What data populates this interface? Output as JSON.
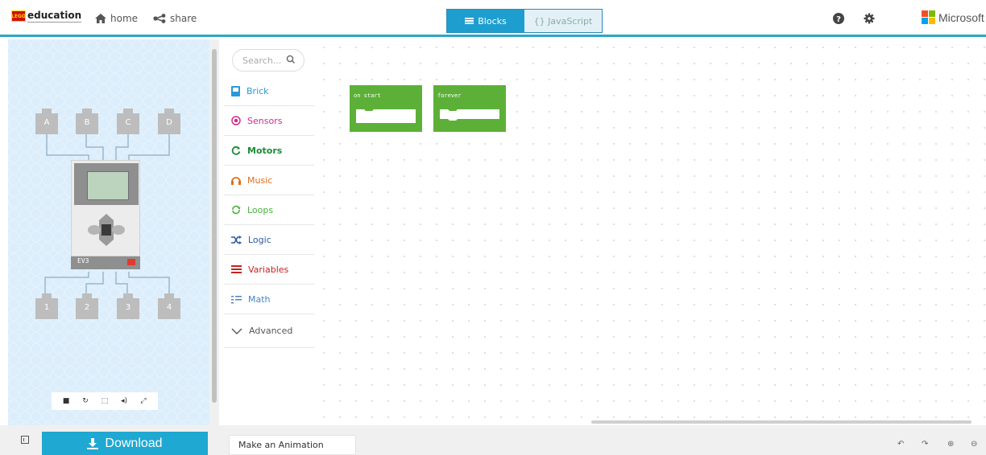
{
  "header": {
    "logo_brand": "LEGO",
    "logo_text": "education",
    "nav": {
      "home": "home",
      "share": "share"
    },
    "editor_toggle": {
      "blocks": "Blocks",
      "javascript": "{} JavaScript",
      "active": "Blocks"
    },
    "microsoft": "Microsoft",
    "icons": [
      "help-icon",
      "settings-icon"
    ]
  },
  "simulator": {
    "input_ports_top": [
      "A",
      "B",
      "C",
      "D"
    ],
    "ports_bottom": [
      "1",
      "2",
      "3",
      "4"
    ],
    "brick_label": "EV3",
    "controls": [
      "stop-icon",
      "restart-icon",
      "screenshot-icon",
      "sound-icon",
      "fullscreen-icon"
    ]
  },
  "toolbox": {
    "search_placeholder": "Search...",
    "categories": [
      {
        "label": "Brick",
        "color": "#2b98d9",
        "icon": "brick-icon"
      },
      {
        "label": "Sensors",
        "color": "#d32a8f",
        "icon": "sensors-icon"
      },
      {
        "label": "Motors",
        "color": "#1b8a37",
        "icon": "motors-icon"
      },
      {
        "label": "Music",
        "color": "#e06f1c",
        "icon": "music-icon"
      },
      {
        "label": "Loops",
        "color": "#47b13a",
        "icon": "loops-icon"
      },
      {
        "label": "Logic",
        "color": "#2959a8",
        "icon": "logic-icon"
      },
      {
        "label": "Variables",
        "color": "#c3221f",
        "icon": "variables-icon"
      },
      {
        "label": "Math",
        "color": "#4a84c6",
        "icon": "math-icon"
      },
      {
        "label": "Advanced",
        "color": "#555555",
        "icon": "chevron-down-icon"
      }
    ]
  },
  "workspace": {
    "blocks": [
      {
        "label": "on start",
        "color": "#5cb037"
      },
      {
        "label": "forever",
        "color": "#5cb037"
      }
    ]
  },
  "footer": {
    "download": "Download",
    "project_name": "Make an Animation",
    "controls": [
      "undo-icon",
      "redo-icon",
      "zoom-in-icon",
      "zoom-out-icon"
    ]
  }
}
